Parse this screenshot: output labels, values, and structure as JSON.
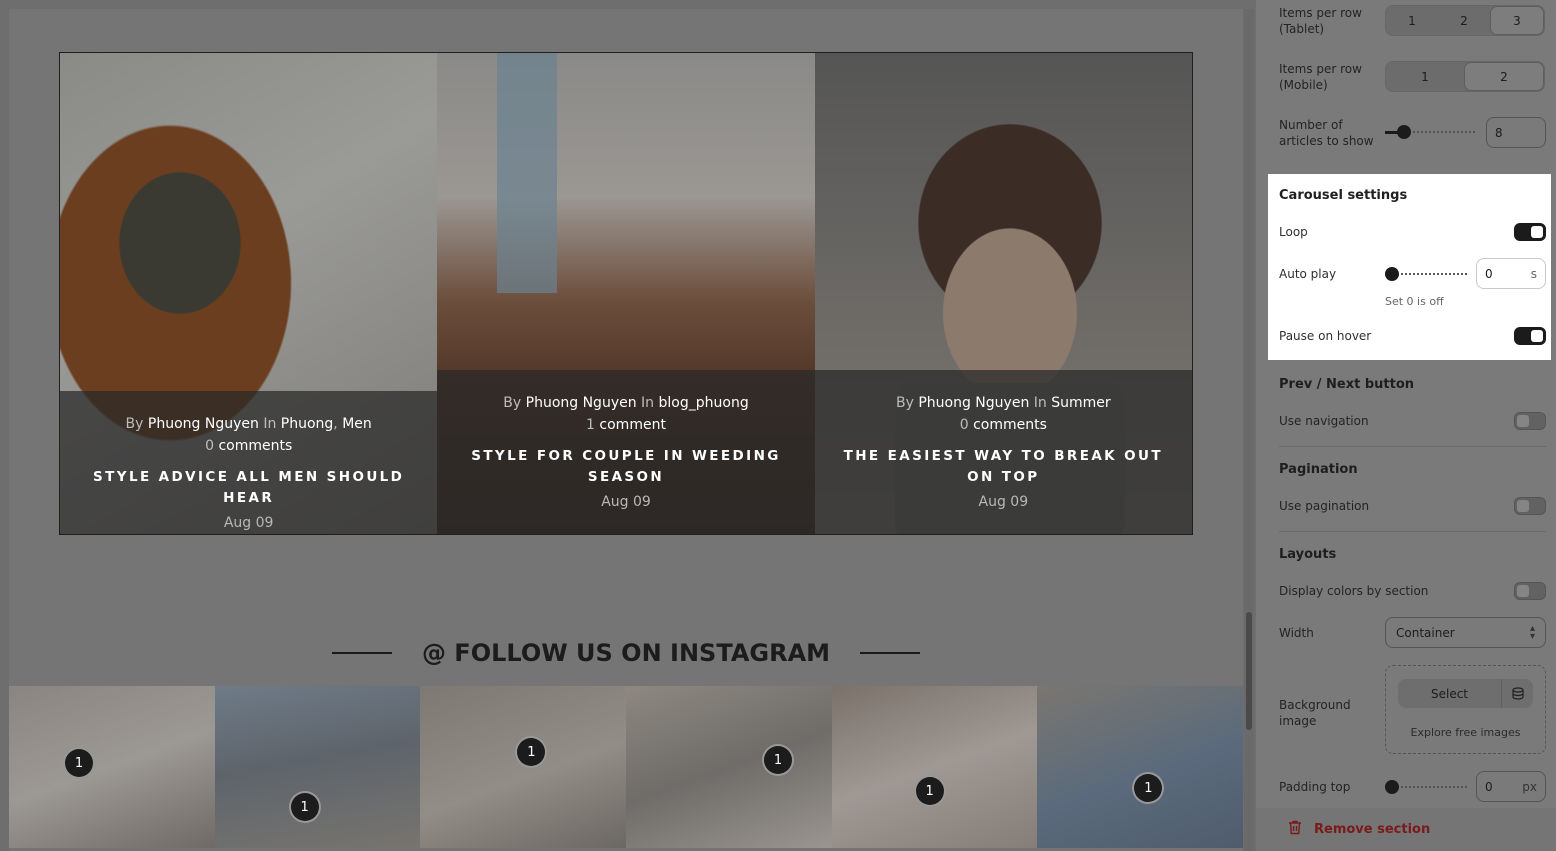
{
  "articles": [
    {
      "by": "By",
      "author": "Phuong Nguyen",
      "in": "In",
      "category": "Phuong",
      "category2": "Men",
      "comment_count": "0",
      "comment_word": "comments",
      "title": "STYLE ADVICE ALL MEN SHOULD HEAR",
      "date": "Aug 09"
    },
    {
      "by": "By",
      "author": "Phuong Nguyen",
      "in": "In",
      "category": "blog_phuong",
      "comment_count": "1",
      "comment_word": "comment",
      "title": "STYLE FOR COUPLE IN WEEDING SEASON",
      "date": "Aug 09"
    },
    {
      "by": "By",
      "author": "Phuong Nguyen",
      "in": "In",
      "category": "Summer",
      "comment_count": "0",
      "comment_word": "comments",
      "title": "THE EASIEST WAY TO BREAK OUT ON TOP",
      "date": "Aug 09"
    }
  ],
  "instagram": {
    "heading": "@ FOLLOW US ON INSTAGRAM",
    "hotspot_label": "1"
  },
  "settings": {
    "items_tablet": {
      "label": "Items per row (Tablet)",
      "options": [
        "1",
        "2",
        "3"
      ],
      "selected": "3"
    },
    "items_mobile": {
      "label": "Items per row (Mobile)",
      "options": [
        "1",
        "2"
      ],
      "selected": "2"
    },
    "articles_to_show": {
      "label": "Number of articles to show",
      "value": "8"
    },
    "carousel": {
      "heading": "Carousel settings",
      "loop_label": "Loop",
      "loop_on": true,
      "autoplay_label": "Auto play",
      "autoplay_value": "0",
      "autoplay_unit": "s",
      "autoplay_help": "Set 0 is off",
      "pause_label": "Pause on hover",
      "pause_on": true
    },
    "prevnext": {
      "heading": "Prev / Next button",
      "label": "Use navigation",
      "on": false
    },
    "pagination": {
      "heading": "Pagination",
      "label": "Use pagination",
      "on": false
    },
    "layouts": {
      "heading": "Layouts",
      "display_colors_label": "Display colors by section",
      "display_colors_on": false,
      "width_label": "Width",
      "width_value": "Container",
      "bg_label": "Background image",
      "select_label": "Select",
      "explore_label": "Explore free images",
      "padding_top_label": "Padding top",
      "padding_top_value": "0",
      "padding_top_unit": "px"
    },
    "remove_label": "Remove section"
  }
}
